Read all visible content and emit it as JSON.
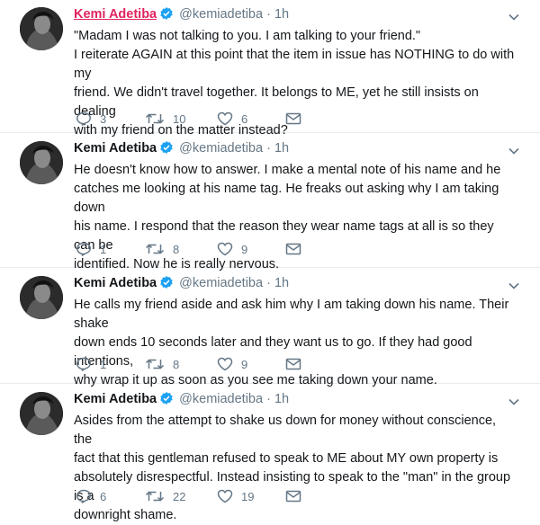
{
  "tweets": [
    {
      "name": "Kemi Adetiba",
      "handle": "@kemiadetiba",
      "time": "1h",
      "lines": [
        "\"Madam I was not talking to you. I am talking to your friend.\"",
        "I reiterate AGAIN at this point that the item in issue has NOTHING to do with my",
        "friend. We didn't travel together. It belongs to ME, yet he still insists on dealing",
        "with my friend on the matter instead?"
      ],
      "replies": "3",
      "retweets": "10",
      "likes": "6"
    },
    {
      "name": "Kemi Adetiba",
      "handle": "@kemiadetiba",
      "time": "1h",
      "lines": [
        "He doesn't know how to answer. I make a mental note of his name and he",
        "catches me looking at his name tag. He freaks out asking why I am taking down",
        "his name. I respond that the reason they wear name tags at all is so they can be",
        "identified. Now he is really nervous."
      ],
      "replies": "1",
      "retweets": "8",
      "likes": "9"
    },
    {
      "name": "Kemi Adetiba",
      "handle": "@kemiadetiba",
      "time": "1h",
      "lines": [
        "He calls my friend aside and ask him why I am taking down his name. Their shake",
        "down ends 10 seconds later and they want us to go. If they had good intentions,",
        "why wrap it up as soon as you see me taking down your name."
      ],
      "replies": "1",
      "retweets": "8",
      "likes": "9"
    },
    {
      "name": "Kemi Adetiba",
      "handle": "@kemiadetiba",
      "time": "1h",
      "lines": [
        "Asides from the attempt to shake us down for money without conscience, the",
        "fact that this gentleman refused to speak to ME about MY own property is",
        "absolutely disrespectful. Instead insisting to speak to the \"man\" in the group is a",
        "downright shame."
      ],
      "replies": "6",
      "retweets": "22",
      "likes": "19"
    }
  ],
  "colors": {
    "accent": "#1da1f2",
    "secondary": "#657786",
    "name_highlight": "#e0245e",
    "divider": "#e6ecf0"
  },
  "icons": [
    "verified-badge-icon",
    "chevron-down-icon",
    "reply-icon",
    "retweet-icon",
    "like-icon",
    "direct-message-icon"
  ]
}
